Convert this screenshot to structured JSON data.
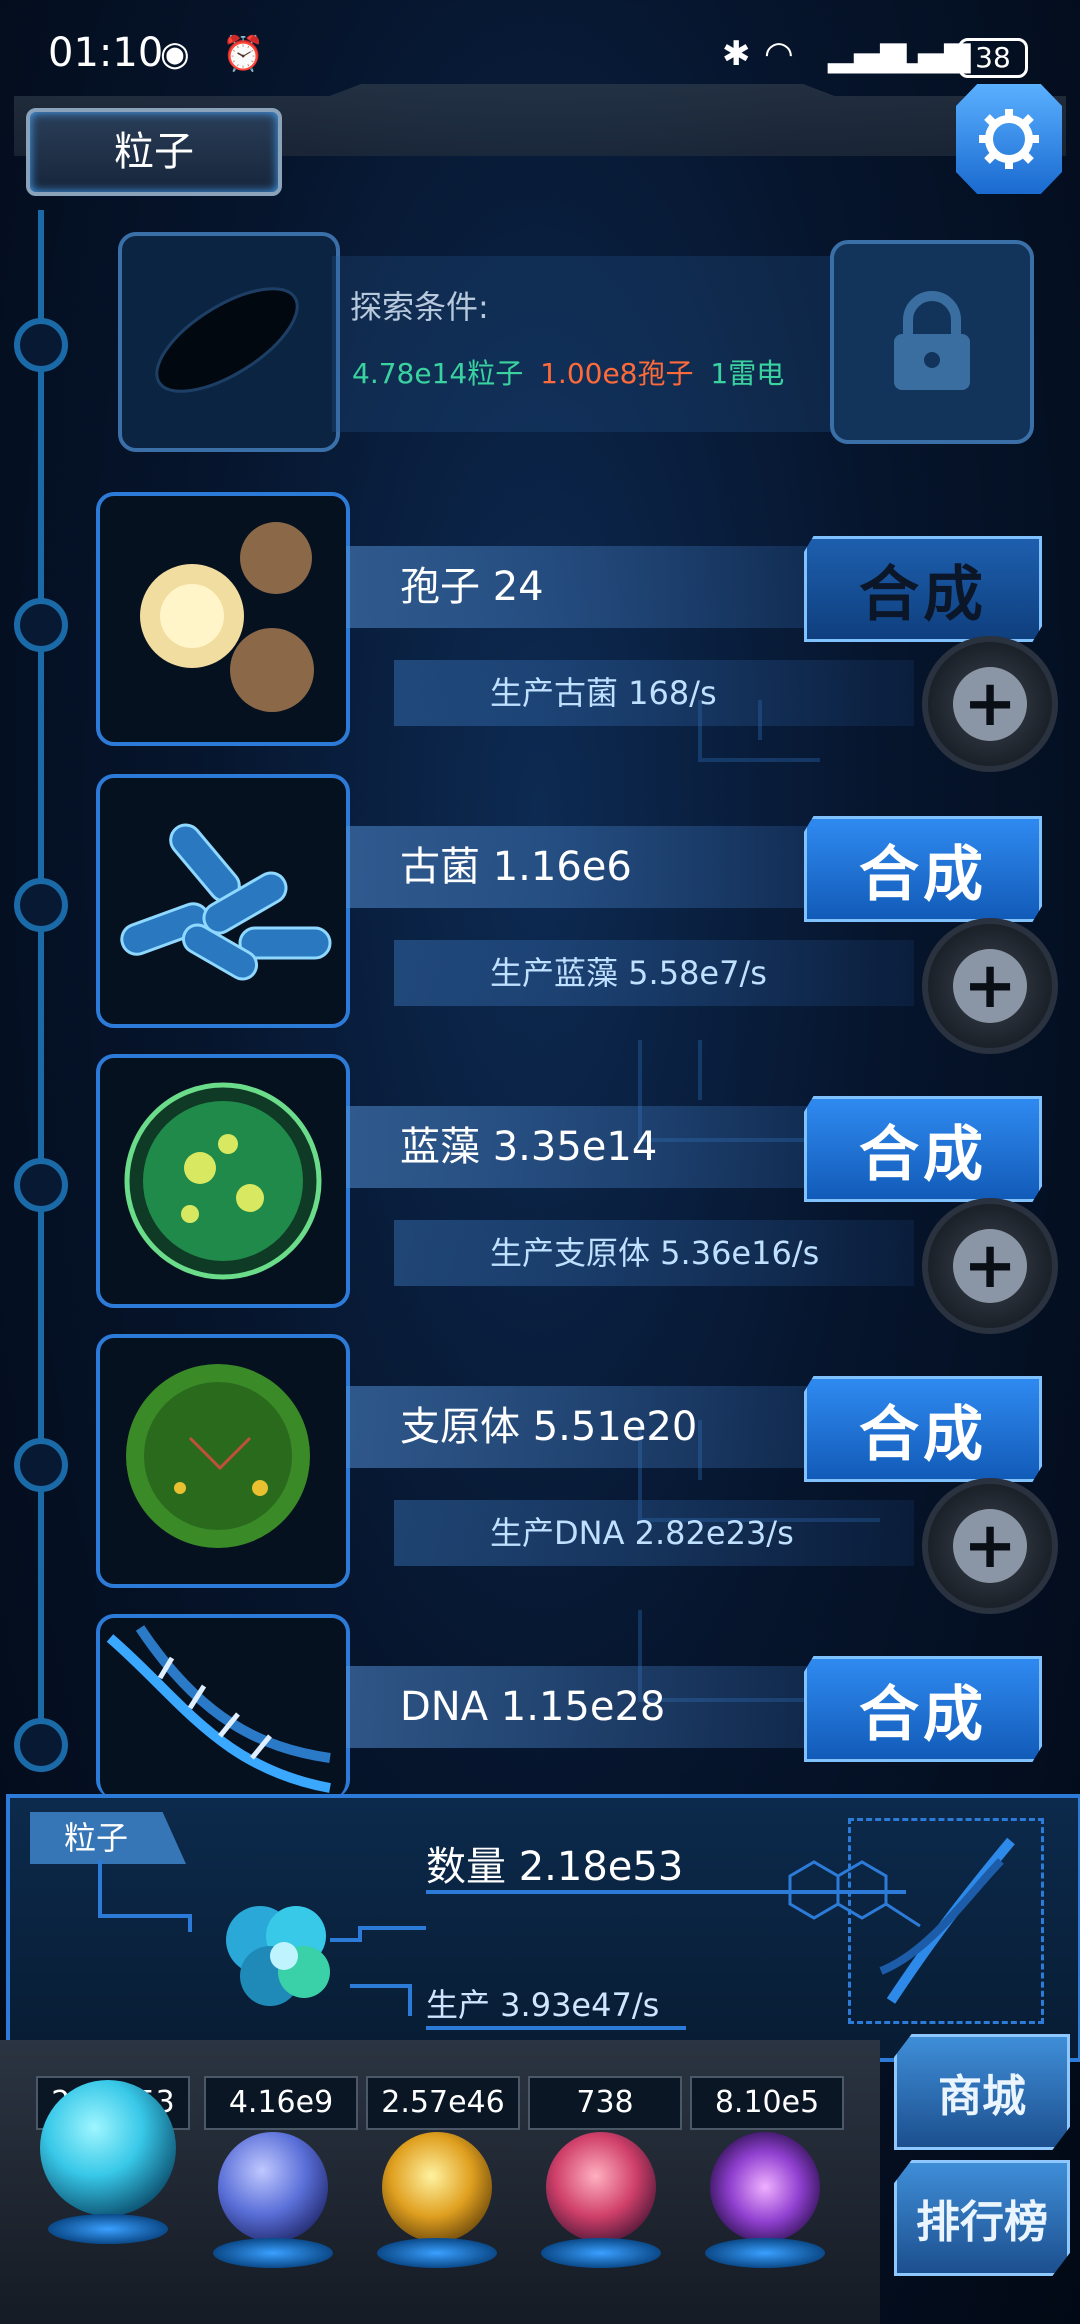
{
  "status_bar": {
    "time": "01:10",
    "battery": "38"
  },
  "header": {
    "tab_label": "粒子"
  },
  "exploration": {
    "title": "探索条件:",
    "requirements": [
      {
        "text": "4.78e14粒子",
        "color": "#3ad3a0"
      },
      {
        "text": "1.00e8孢子",
        "color": "#ff6a3a"
      },
      {
        "text": "1雷电",
        "color": "#3ad3a0"
      }
    ]
  },
  "units": [
    {
      "name": "孢子 24",
      "production": "生产古菌 168/s",
      "combine_label": "合成",
      "enabled": false,
      "icon": "spore-icon"
    },
    {
      "name": "古菌 1.16e6",
      "production": "生产蓝藻 5.58e7/s",
      "combine_label": "合成",
      "enabled": true,
      "icon": "archaea-icon"
    },
    {
      "name": "蓝藻 3.35e14",
      "production": "生产支原体 5.36e16/s",
      "combine_label": "合成",
      "enabled": true,
      "icon": "cyanobacteria-icon"
    },
    {
      "name": "支原体 5.51e20",
      "production": "生产DNA 2.82e23/s",
      "combine_label": "合成",
      "enabled": true,
      "icon": "mycoplasma-icon"
    },
    {
      "name": "DNA 1.15e28",
      "production": "",
      "combine_label": "合成",
      "enabled": true,
      "icon": "dna-icon"
    }
  ],
  "panel": {
    "tag": "粒子",
    "quantity": "数量 2.18e53",
    "production": "生产 3.93e47/s"
  },
  "resources": [
    {
      "value": "2.18e53",
      "icon": "particle-orb-icon",
      "color": "#38c8e8"
    },
    {
      "value": "4.16e9",
      "icon": "lightning-orb-icon",
      "color": "#5a6fd8"
    },
    {
      "value": "2.57e46",
      "icon": "explosion-orb-icon",
      "color": "#e0a020"
    },
    {
      "value": "738",
      "icon": "brain-orb-icon",
      "color": "#d0406a"
    },
    {
      "value": "8.10e5",
      "icon": "vortex-orb-icon",
      "color": "#9040d0"
    }
  ],
  "side_buttons": {
    "shop": "商城",
    "ranking": "排行榜"
  }
}
